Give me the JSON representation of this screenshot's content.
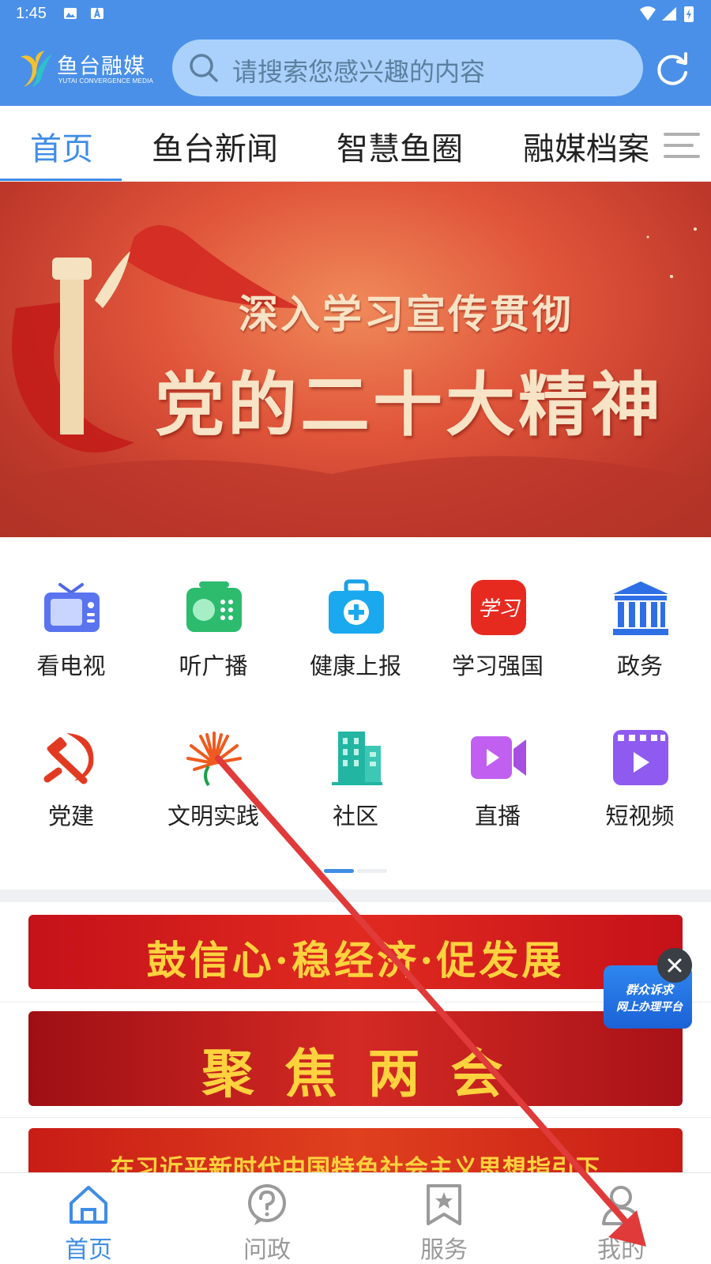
{
  "status_bar": {
    "time": "1:45"
  },
  "header": {
    "logo_name": "鱼台融媒",
    "logo_sub": "YUTAI CONVERGENCE MEDIA",
    "search_placeholder": "请搜索您感兴趣的内容"
  },
  "tabs": [
    {
      "label": "首页",
      "active": true
    },
    {
      "label": "鱼台新闻"
    },
    {
      "label": "智慧鱼圈"
    },
    {
      "label": "融媒档案"
    }
  ],
  "banner": {
    "line1": "深入学习宣传贯彻",
    "line2": "党的二十大精神"
  },
  "grid": [
    {
      "label": "看电视",
      "icon": "tv-icon"
    },
    {
      "label": "听广播",
      "icon": "radio-icon"
    },
    {
      "label": "健康上报",
      "icon": "medical-kit-icon"
    },
    {
      "label": "学习强国",
      "icon": "xuexi-qiangguo-icon"
    },
    {
      "label": "政务",
      "icon": "government-building-icon"
    },
    {
      "label": "党建",
      "icon": "hammer-sickle-icon"
    },
    {
      "label": "文明实践",
      "icon": "civilization-practice-icon"
    },
    {
      "label": "社区",
      "icon": "community-building-icon"
    },
    {
      "label": "直播",
      "icon": "live-video-icon"
    },
    {
      "label": "短视频",
      "icon": "short-video-icon"
    }
  ],
  "pager": {
    "pages": 2,
    "current": 1
  },
  "promos": [
    {
      "text": "鼓信心·稳经济·促发展"
    },
    {
      "text": "聚 焦 两 会"
    },
    {
      "text": "在习近平新时代中国特色社会主义思想指引下"
    }
  ],
  "float_widget": {
    "line1": "群众诉求",
    "line2": "网上办理平台"
  },
  "bottom_nav": [
    {
      "label": "首页",
      "icon": "home-icon",
      "active": true
    },
    {
      "label": "问政",
      "icon": "question-icon"
    },
    {
      "label": "服务",
      "icon": "service-star-icon"
    },
    {
      "label": "我的",
      "icon": "profile-icon"
    }
  ],
  "colors": {
    "header": "#4a90e9",
    "accent": "#3f8de5",
    "promo_red": "#c8161d",
    "promo_text": "#ffd23e"
  }
}
